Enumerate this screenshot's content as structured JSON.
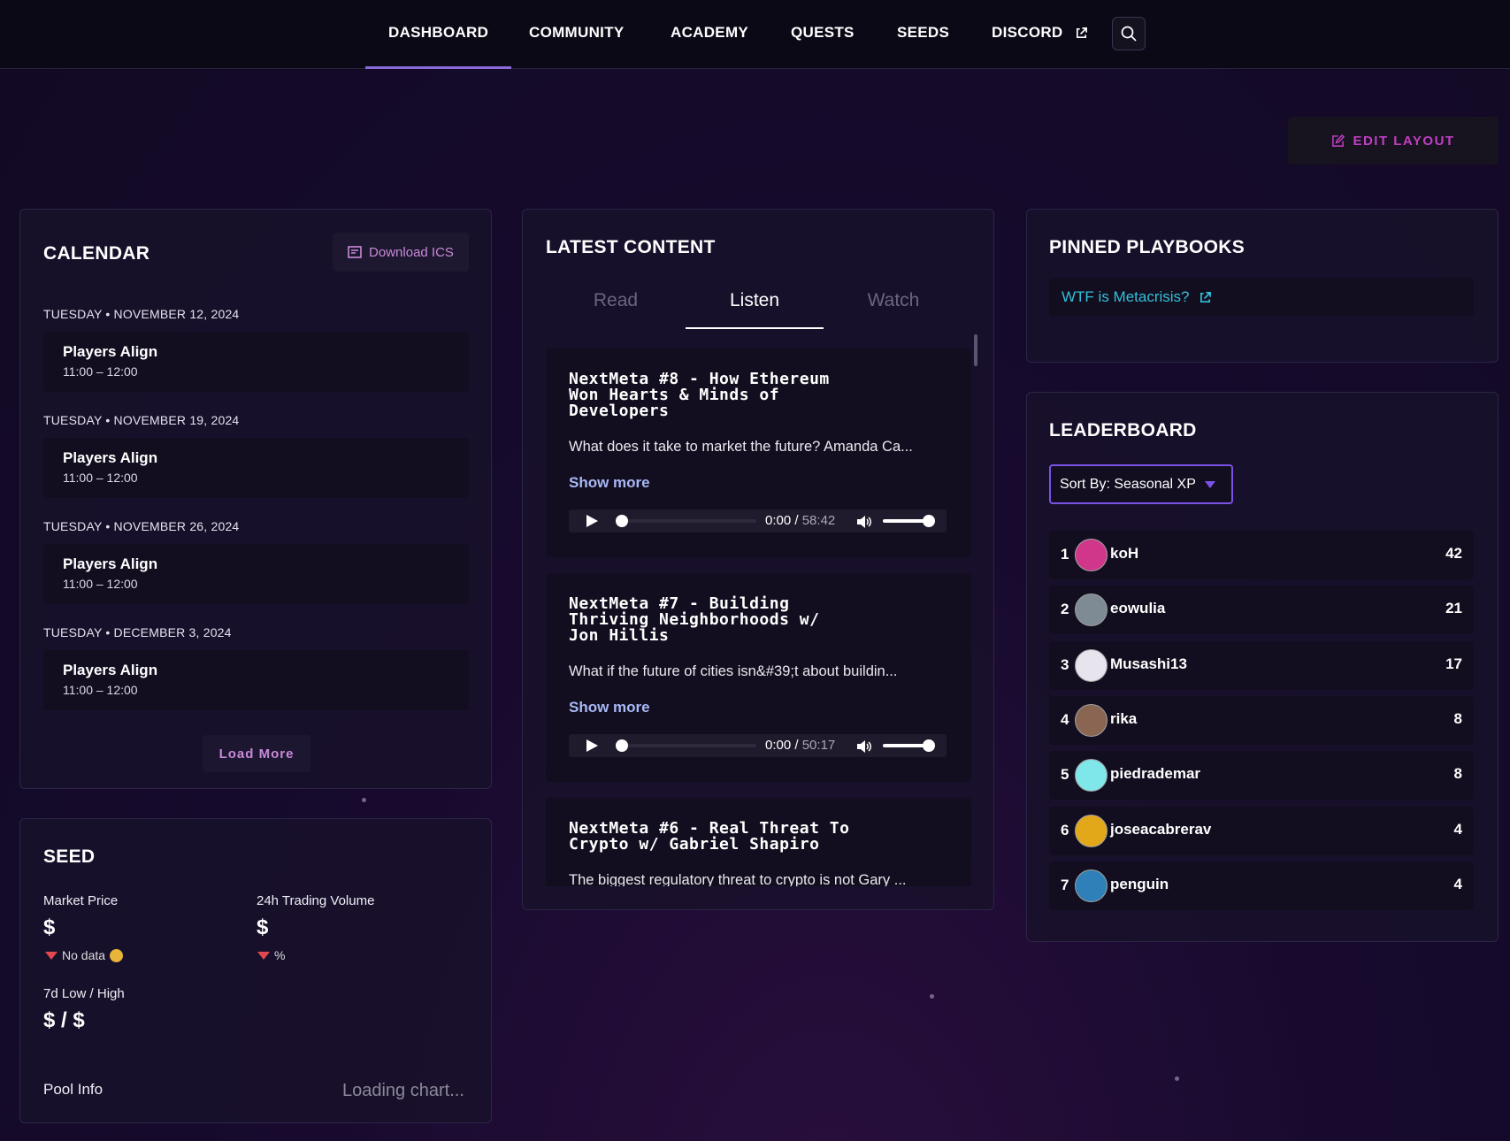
{
  "nav": {
    "items": [
      "DASHBOARD",
      "COMMUNITY",
      "ACADEMY",
      "QUESTS",
      "SEEDS",
      "DISCORD"
    ],
    "active": "DASHBOARD"
  },
  "toolbar": {
    "edit_layout": "EDIT LAYOUT"
  },
  "calendar": {
    "title": "CALENDAR",
    "download": "Download ICS",
    "events": [
      {
        "date": "TUESDAY • NOVEMBER 12, 2024",
        "title": "Players Align",
        "time": "11:00 – 12:00"
      },
      {
        "date": "TUESDAY • NOVEMBER 19, 2024",
        "title": "Players Align",
        "time": "11:00 – 12:00"
      },
      {
        "date": "TUESDAY • NOVEMBER 26, 2024",
        "title": "Players Align",
        "time": "11:00 – 12:00"
      },
      {
        "date": "TUESDAY • DECEMBER 3, 2024",
        "title": "Players Align",
        "time": "11:00 – 12:00"
      }
    ],
    "load_more": "Load More"
  },
  "seed": {
    "title": "SEED",
    "market_price_label": "Market Price",
    "market_price_value": "$",
    "market_price_change": "No data",
    "volume_label": "24h Trading Volume",
    "volume_value": "$",
    "volume_change": "%",
    "range_label": "7d Low / High",
    "range_value": "$ / $",
    "pool_label": "Pool Info",
    "pool_status": "Loading chart..."
  },
  "content": {
    "title": "LATEST CONTENT",
    "tabs": [
      "Read",
      "Listen",
      "Watch"
    ],
    "active_tab": "Listen",
    "show_more": "Show more",
    "items": [
      {
        "title": "NextMeta #8 - How Ethereum\nWon Hearts & Minds of\nDevelopers",
        "desc": "What does it take to market the future? Amanda Ca...",
        "current": "0:00",
        "duration": "58:42"
      },
      {
        "title": "NextMeta #7 - Building\nThriving Neighborhoods w/\nJon Hillis",
        "desc": "What if the future of cities isn&#39;t about buildin...",
        "current": "0:00",
        "duration": "50:17"
      },
      {
        "title": "NextMeta #6 - Real Threat To\nCrypto w/ Gabriel Shapiro",
        "desc": "The biggest regulatory threat to crypto is not Gary ...",
        "current": "",
        "duration": ""
      }
    ]
  },
  "playbooks": {
    "title": "PINNED PLAYBOOKS",
    "items": [
      "WTF is Metacrisis?"
    ]
  },
  "leaderboard": {
    "title": "LEADERBOARD",
    "sort_label": "Sort By: Seasonal XP",
    "rows": [
      {
        "rank": "1",
        "name": "koH",
        "score": "42",
        "avatar_color": "#d0378a"
      },
      {
        "rank": "2",
        "name": "eowulia",
        "score": "21",
        "avatar_color": "#7e8a94"
      },
      {
        "rank": "3",
        "name": "Musashi13",
        "score": "17",
        "avatar_color": "#e8e4ee"
      },
      {
        "rank": "4",
        "name": "rika",
        "score": "8",
        "avatar_color": "#8a6552"
      },
      {
        "rank": "5",
        "name": "piedrademar",
        "score": "8",
        "avatar_color": "#7fe6ea"
      },
      {
        "rank": "6",
        "name": "joseacabrerav",
        "score": "4",
        "avatar_color": "#e2a81a"
      },
      {
        "rank": "7",
        "name": "penguin",
        "score": "4",
        "avatar_color": "#2f7fb8"
      }
    ]
  }
}
